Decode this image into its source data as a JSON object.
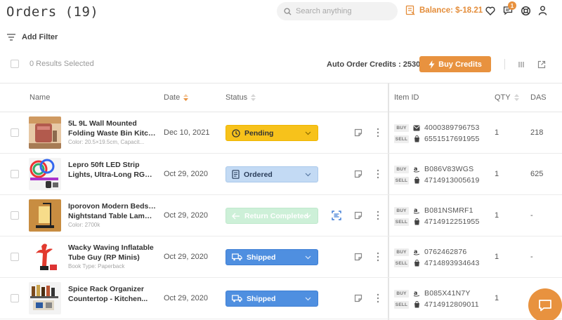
{
  "header": {
    "title": "Orders (19)",
    "search_placeholder": "Search anything",
    "balance": "Balance: $-18.21",
    "notification_count": "1"
  },
  "filters": {
    "add_filter_label": "Add Filter"
  },
  "selection": {
    "results_selected": "0 Results Selected"
  },
  "credits": {
    "label": "Auto Order Credits : 2530",
    "buy_label": "Buy Credits"
  },
  "table": {
    "columns": {
      "name": "Name",
      "date": "Date",
      "status": "Status",
      "item_id": "Item ID",
      "qty": "QTY",
      "das": "DAS"
    },
    "rows": [
      {
        "name_line1": "5L 9L Wall Mounted",
        "name_line2": "Folding Waste Bin Kitch...",
        "variant": "Color: 20.5×19.5cm, Capacit...",
        "date": "Dec 10, 2021",
        "status": "Pending",
        "buy_id": "4000389796753",
        "sell_id": "6551517691955",
        "buy_source": "aliexpress",
        "sell_source": "shopify",
        "qty": "1",
        "das": "218"
      },
      {
        "name_line1": "Lepro 50ft LED Strip",
        "name_line2": "Lights, Ultra-Long RGB...",
        "variant": "",
        "date": "Oct 29, 2020",
        "status": "Ordered",
        "buy_id": "B086V83WGS",
        "sell_id": "4714913005619",
        "buy_source": "amazon",
        "sell_source": "shopify",
        "qty": "1",
        "das": "625"
      },
      {
        "name_line1": "Iporovon Modern Bedside",
        "name_line2": "Nightstand Table Lamp,...",
        "variant": "Color: 2700k",
        "date": "Oct 29, 2020",
        "status": "Return Completed",
        "buy_id": "B081NSMRF1",
        "sell_id": "4714912251955",
        "buy_source": "amazon",
        "sell_source": "shopify",
        "qty": "1",
        "das": "-"
      },
      {
        "name_line1": "Wacky Waving Inflatable",
        "name_line2": "Tube Guy (RP Minis)",
        "variant": "Book Type: Paperback",
        "date": "Oct 29, 2020",
        "status": "Shipped",
        "buy_id": "0762462876",
        "sell_id": "4714893934643",
        "buy_source": "amazon",
        "sell_source": "shopify",
        "qty": "1",
        "das": "-"
      },
      {
        "name_line1": "Spice Rack Organizer",
        "name_line2": "Countertop - Kitchen...",
        "variant": "",
        "date": "Oct 29, 2020",
        "status": "Shipped",
        "buy_id": "B085X41N7Y",
        "sell_id": "4714912809011",
        "buy_source": "amazon",
        "sell_source": "shopify",
        "qty": "1",
        "das": ""
      }
    ],
    "tags": {
      "buy": "BUY",
      "sell": "SELL"
    }
  },
  "colors": {
    "accent": "#e8923f",
    "pending": "#f7c21b",
    "ordered": "#c3daf4",
    "return": "#cdf0d8",
    "shipped": "#4f8fe0"
  }
}
